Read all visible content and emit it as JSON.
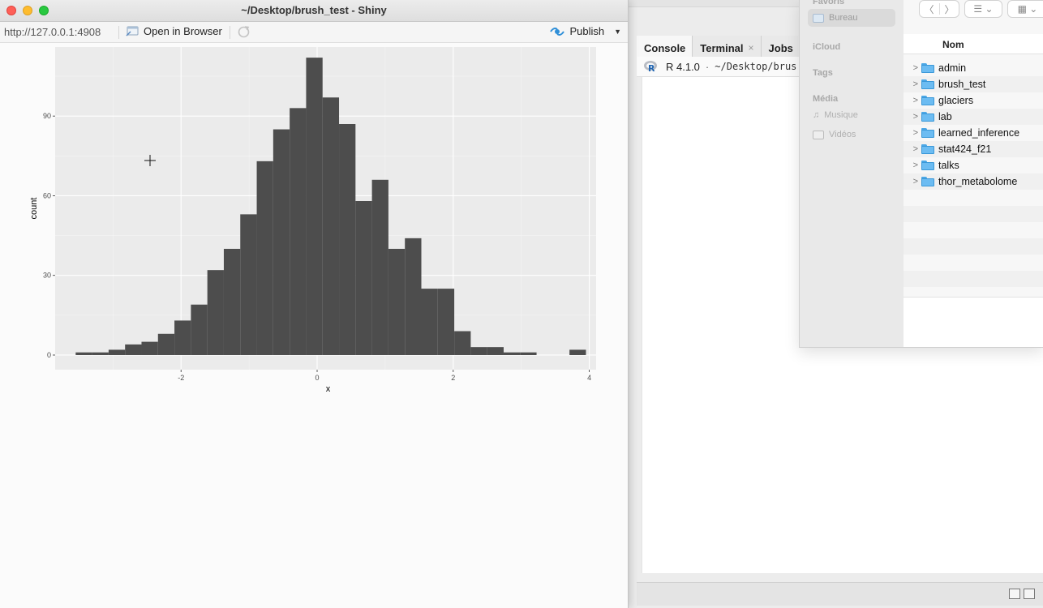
{
  "rstudio": {
    "tabs": [
      {
        "label": "Console",
        "closable": false,
        "active": true
      },
      {
        "label": "Terminal",
        "closable": true,
        "active": false
      },
      {
        "label": "Jobs",
        "closable": false,
        "active": false
      }
    ],
    "console_version": "R 4.1.0",
    "console_sep": "·",
    "console_path": "~/Desktop/brus"
  },
  "finder": {
    "sidebar": {
      "favorites_header": "Favoris",
      "bureau": "Bureau",
      "icloud_header": "iCloud",
      "tags_header": "Tags",
      "media_header": "Média",
      "music": "Musique",
      "videos": "Vidéos"
    },
    "column_header": "Nom",
    "folders": [
      "admin",
      "brush_test",
      "glaciers",
      "lab",
      "learned_inference",
      "stat424_f21",
      "talks",
      "thor_metabolome"
    ]
  },
  "shiny": {
    "window_title": "~/Desktop/brush_test - Shiny",
    "url": "http://127.0.0.1:4908",
    "open_browser_label": "Open in Browser",
    "publish_label": "Publish"
  },
  "colors": {
    "bar_fill": "#4d4d4d",
    "panel_bg": "#ebebeb",
    "publish_blue": "#2f8fd8",
    "folder_blue": "#6cbcf2"
  },
  "chart_data": {
    "type": "bar",
    "subtype": "histogram",
    "xlabel": "x",
    "ylabel": "count",
    "xlim": [
      -3.85,
      4.1
    ],
    "ylim": [
      -5.5,
      116
    ],
    "x_ticks": [
      -2,
      0,
      2,
      4
    ],
    "y_ticks": [
      0,
      30,
      60,
      90
    ],
    "bin_width": 0.2419,
    "bin_start": -3.5484,
    "counts": [
      1,
      1,
      2,
      4,
      5,
      8,
      13,
      19,
      32,
      40,
      53,
      73,
      85,
      93,
      112,
      97,
      87,
      58,
      66,
      40,
      44,
      25,
      25,
      9,
      3,
      3,
      1,
      1,
      0,
      0,
      2
    ],
    "grid": true
  }
}
